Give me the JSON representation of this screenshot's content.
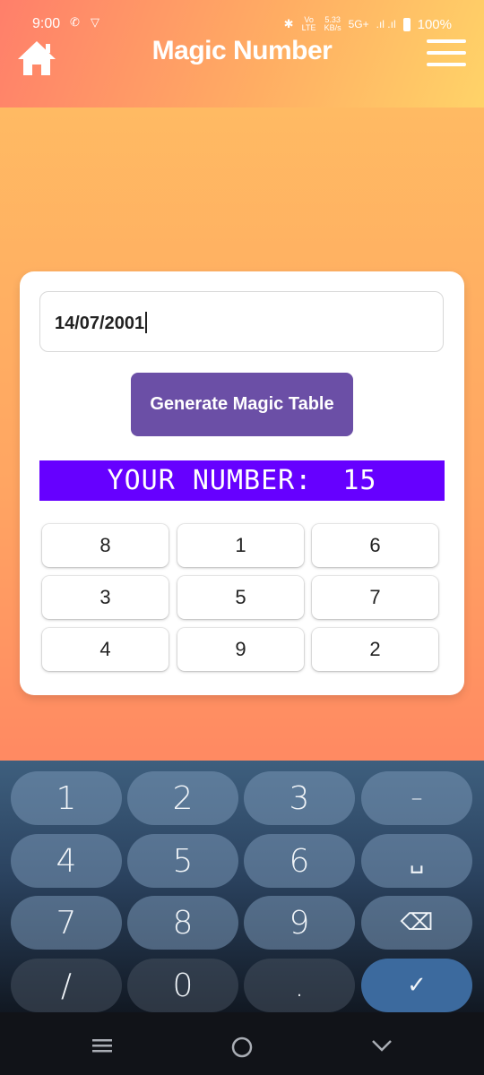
{
  "status_bar": {
    "time": "9:00",
    "speed_top": "5.33",
    "speed_unit": "KB/s",
    "volte": "Vo LTE",
    "network": "5G+",
    "battery": "100%"
  },
  "header": {
    "title": "Magic Number",
    "home_icon": "home-icon",
    "menu_icon": "hamburger-menu-icon"
  },
  "card": {
    "date_value": "14/07/2001",
    "generate_label": "Generate Magic Table",
    "number_label": "YOUR NUMBER:",
    "number_value": "15",
    "grid": [
      [
        "8",
        "1",
        "6"
      ],
      [
        "3",
        "5",
        "7"
      ],
      [
        "4",
        "9",
        "2"
      ]
    ]
  },
  "keyboard": {
    "keys": [
      "1",
      "2",
      "3",
      "–",
      "4",
      "5",
      "6",
      "␣",
      "7",
      "8",
      "9",
      "⌫",
      "/",
      "0",
      ".",
      "✓"
    ]
  },
  "nav": {
    "recents_icon": "recents-icon",
    "home_icon": "nav-home-icon",
    "back_icon": "back-icon"
  },
  "colors": {
    "accent_purple": "#6b4fa6",
    "banner": "#6600ff",
    "done_key": "#3c6a9e"
  }
}
